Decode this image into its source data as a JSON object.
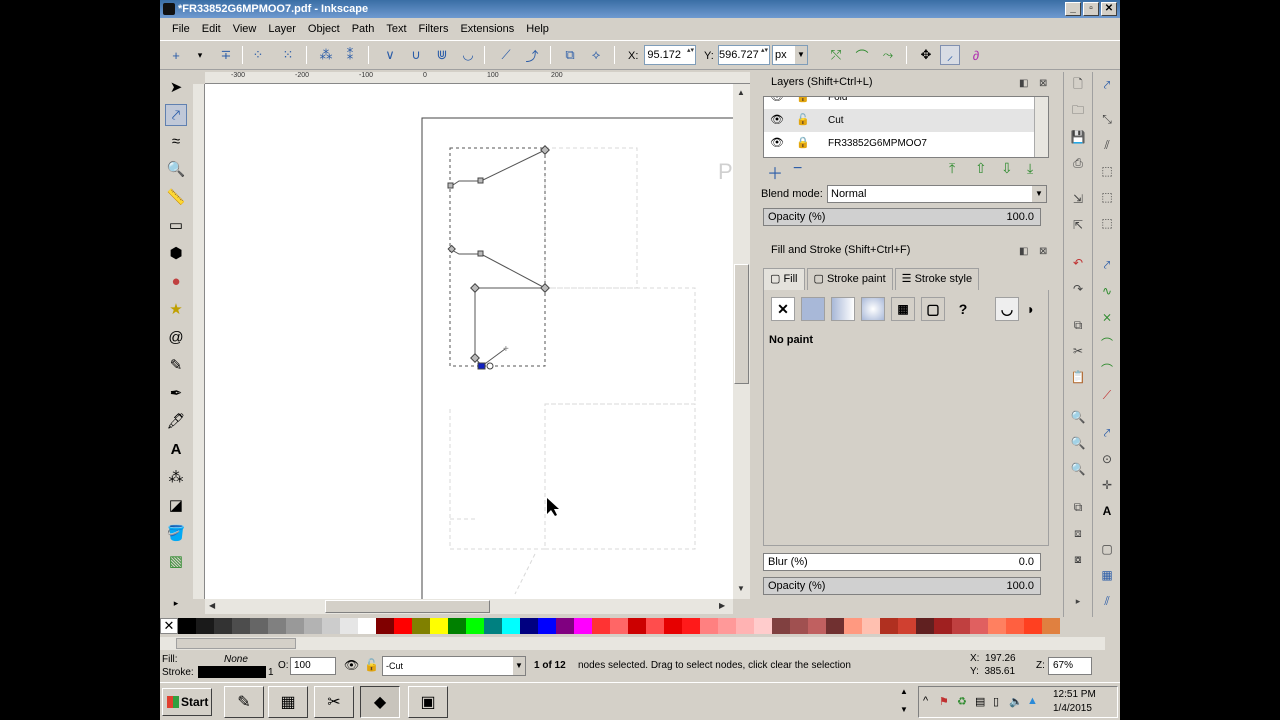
{
  "window": {
    "title": "*FR33852G6MPMOO7.pdf - Inkscape",
    "btn_min": "_",
    "btn_max": "▫",
    "btn_close": "✕"
  },
  "menu": [
    "File",
    "Edit",
    "View",
    "Layer",
    "Object",
    "Path",
    "Text",
    "Filters",
    "Extensions",
    "Help"
  ],
  "toolbar": {
    "x_label": "X:",
    "x_value": "95.172",
    "y_label": "Y:",
    "y_value": "596.727",
    "unit": "px"
  },
  "ruler": {
    "ticks": [
      "-300",
      "-200",
      "-100",
      "0",
      "100",
      "200"
    ]
  },
  "layers_panel": {
    "title": "Layers (Shift+Ctrl+L)",
    "rows": [
      "Fold",
      "Cut",
      "FR33852G6MPMOO7"
    ],
    "blend_label": "Blend mode:",
    "blend_value": "Normal",
    "opacity_label": "Opacity (%)",
    "opacity_value": "100.0"
  },
  "fill_stroke_panel": {
    "title": "Fill and Stroke (Shift+Ctrl+F)",
    "tabs": [
      "Fill",
      "Stroke paint",
      "Stroke style"
    ],
    "paint_status": "No paint",
    "blur_label": "Blur (%)",
    "blur_value": "0.0",
    "opacity_label": "Opacity (%)",
    "opacity_value": "100.0"
  },
  "palette": [
    "#000000",
    "#1a1a1a",
    "#333333",
    "#4d4d4d",
    "#666666",
    "#808080",
    "#999999",
    "#b3b3b3",
    "#cccccc",
    "#e6e6e6",
    "#ffffff",
    "#800000",
    "#ff0000",
    "#808000",
    "#ffff00",
    "#008000",
    "#00ff00",
    "#008080",
    "#00ffff",
    "#000080",
    "#0000ff",
    "#800080",
    "#ff00ff",
    "#ff3333",
    "#ff6666",
    "#cc0000",
    "#ff4d4d",
    "#e60000",
    "#ff1a1a",
    "#ff8080",
    "#ff9999",
    "#ffb3b3",
    "#ffcccc",
    "#804040",
    "#a05050",
    "#c06060",
    "#703030",
    "#ff9980",
    "#ffc0b0",
    "#b03020",
    "#d04030",
    "#602020",
    "#a02020",
    "#c04040",
    "#e06060",
    "#ff8060",
    "#ff6040",
    "#ff4020",
    "#e08040"
  ],
  "statusbar": {
    "fill_label": "Fill:",
    "fill_value": "None",
    "stroke_label": "Stroke:",
    "stroke_width": "1",
    "opacity_label": "O:",
    "opacity_value": "100",
    "layer": "-Cut",
    "message_bold": "1 of 12",
    "message": "nodes selected. Drag to select nodes, click clear the selection",
    "x_coord": "X:  197.26",
    "y_coord": "Y:  385.61",
    "zoom_label": "Z:",
    "zoom": "67%"
  },
  "taskbar": {
    "start": "Start",
    "time": "12:51 PM",
    "date": "1/4/2015"
  }
}
